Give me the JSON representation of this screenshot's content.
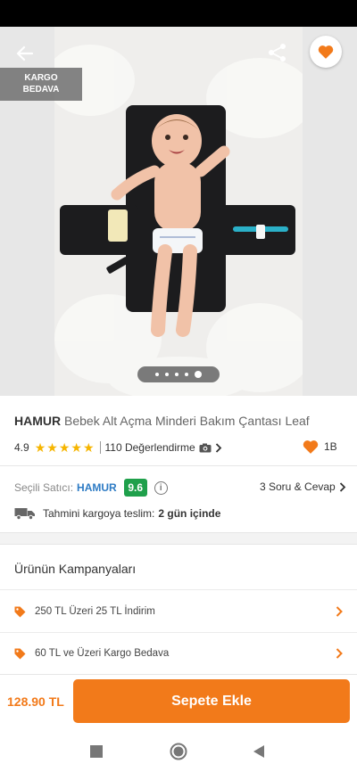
{
  "header": {
    "cargo_badge_line1": "KARGO",
    "cargo_badge_line2": "BEDAVA",
    "icons": {
      "back": "arrow-left-icon",
      "share": "share-icon",
      "favorite": "heart-icon"
    }
  },
  "gallery": {
    "page_count": 5,
    "active_page": 5,
    "image": "baby-changing-mat-photo"
  },
  "product": {
    "brand": "HAMUR",
    "name": "Bebek Alt Açma Minderi Bakım Çantası Leaf",
    "rating": "4.9",
    "stars": 5,
    "reviews_label": "110 Değerlendirme",
    "likes": "1B"
  },
  "seller": {
    "label": "Seçili Satıcı:",
    "name": "HAMUR",
    "score": "9.6",
    "qa_label": "3 Soru & Cevap"
  },
  "delivery": {
    "label": "Tahmini kargoya teslim:",
    "value": "2 gün içinde"
  },
  "campaigns": {
    "title": "Ürünün Kampanyaları",
    "items": [
      {
        "label": "250 TL Üzeri 25 TL İndirim"
      },
      {
        "label": "60 TL ve Üzeri Kargo Bedava"
      }
    ]
  },
  "footer": {
    "price": "128.90 TL",
    "add_to_cart": "Sepete Ekle"
  },
  "colors": {
    "accent": "#f27a1a",
    "seller_link": "#2d7bc4",
    "score_badge": "#1fa04b",
    "star": "#f6b500"
  }
}
